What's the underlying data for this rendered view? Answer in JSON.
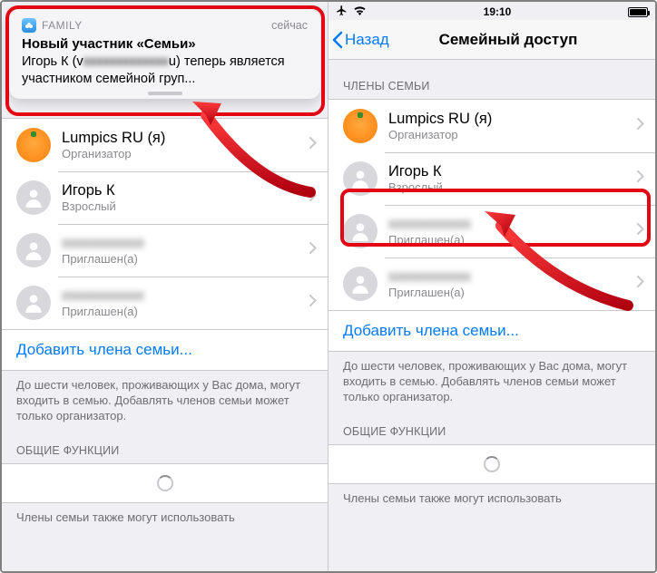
{
  "statusbar": {
    "time": "19:10"
  },
  "nav": {
    "back": "Назад",
    "title": "Семейный доступ"
  },
  "notification": {
    "app": "FAMILY",
    "when": "сейчас",
    "title": "Новый участник «Семьи»",
    "body_prefix": "Игорь К (v",
    "body_blur": "xxxxxxxxxxxxx",
    "body_suffix": "u) теперь является участником семейной груп..."
  },
  "sections": {
    "members_header": "ЧЛЕНЫ СЕМЬИ",
    "shared_header": "ОБЩИЕ ФУНКЦИИ"
  },
  "members": [
    {
      "name": "Lumpics RU (я)",
      "role": "Организатор",
      "avatar": "orange"
    },
    {
      "name": "Игорь К",
      "role": "Взрослый",
      "avatar": "silhouette"
    },
    {
      "name": "________",
      "role": "Приглашен(а)",
      "avatar": "silhouette",
      "blurred": true
    },
    {
      "name": "________",
      "role": "Приглашен(а)",
      "avatar": "silhouette",
      "blurred": true
    }
  ],
  "add_link": "Добавить члена семьи...",
  "footer1": "До шести человек, проживающих у Вас дома, могут входить в семью. Добавлять членов семьи может только организатор.",
  "footer2": "Члены семьи также могут использовать"
}
